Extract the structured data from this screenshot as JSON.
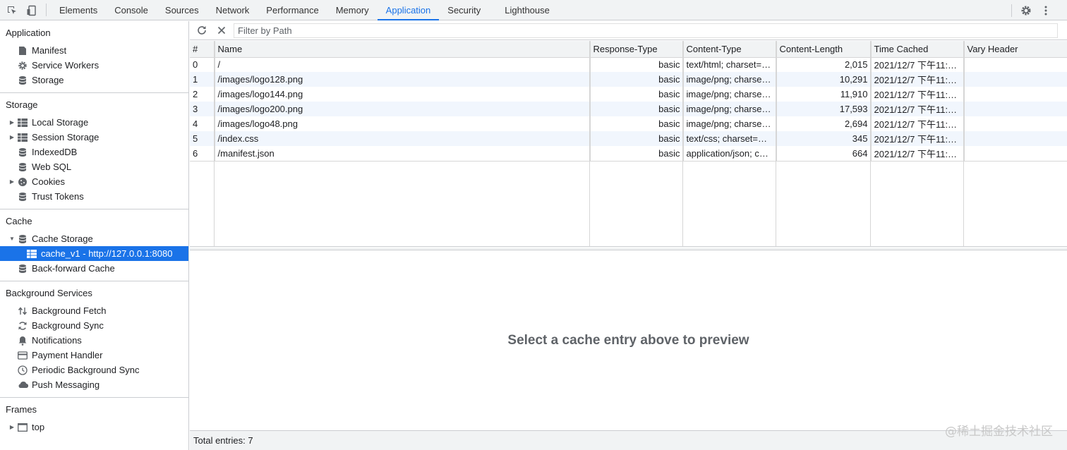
{
  "toolbar": {
    "tabs": [
      "Elements",
      "Console",
      "Sources",
      "Network",
      "Performance",
      "Memory",
      "Application",
      "Security",
      "Lighthouse"
    ],
    "active_tab": "Application"
  },
  "sidebar": {
    "application": {
      "title": "Application",
      "items": [
        "Manifest",
        "Service Workers",
        "Storage"
      ]
    },
    "storage": {
      "title": "Storage",
      "items": [
        "Local Storage",
        "Session Storage",
        "IndexedDB",
        "Web SQL",
        "Cookies",
        "Trust Tokens"
      ]
    },
    "cache": {
      "title": "Cache",
      "items": [
        "Cache Storage",
        "cache_v1 - http://127.0.0.1:8080",
        "Back-forward Cache"
      ]
    },
    "background": {
      "title": "Background Services",
      "items": [
        "Background Fetch",
        "Background Sync",
        "Notifications",
        "Payment Handler",
        "Periodic Background Sync",
        "Push Messaging"
      ]
    },
    "frames": {
      "title": "Frames",
      "items": [
        "top"
      ]
    }
  },
  "filter": {
    "placeholder": "Filter by Path",
    "value": ""
  },
  "table": {
    "columns": [
      "#",
      "Name",
      "Response-Type",
      "Content-Type",
      "Content-Length",
      "Time Cached",
      "Vary Header"
    ],
    "rows": [
      [
        "0",
        "/",
        "basic",
        "text/html; charset=…",
        "2,015",
        "2021/12/7 下午11:…",
        ""
      ],
      [
        "1",
        "/images/logo128.png",
        "basic",
        "image/png; charset…",
        "10,291",
        "2021/12/7 下午11:…",
        ""
      ],
      [
        "2",
        "/images/logo144.png",
        "basic",
        "image/png; charset…",
        "11,910",
        "2021/12/7 下午11:…",
        ""
      ],
      [
        "3",
        "/images/logo200.png",
        "basic",
        "image/png; charset…",
        "17,593",
        "2021/12/7 下午11:…",
        ""
      ],
      [
        "4",
        "/images/logo48.png",
        "basic",
        "image/png; charset…",
        "2,694",
        "2021/12/7 下午11:…",
        ""
      ],
      [
        "5",
        "/index.css",
        "basic",
        "text/css; charset=U…",
        "345",
        "2021/12/7 下午11:…",
        ""
      ],
      [
        "6",
        "/manifest.json",
        "basic",
        "application/json; ch…",
        "664",
        "2021/12/7 下午11:…",
        ""
      ]
    ]
  },
  "preview": {
    "message": "Select a cache entry above to preview"
  },
  "status": {
    "text": "Total entries: 7"
  },
  "watermark": "@稀土掘金技术社区",
  "colors": {
    "accent": "#1a73e8",
    "toolbar_bg": "#f1f3f4",
    "stripe": "#f1f6fd"
  }
}
